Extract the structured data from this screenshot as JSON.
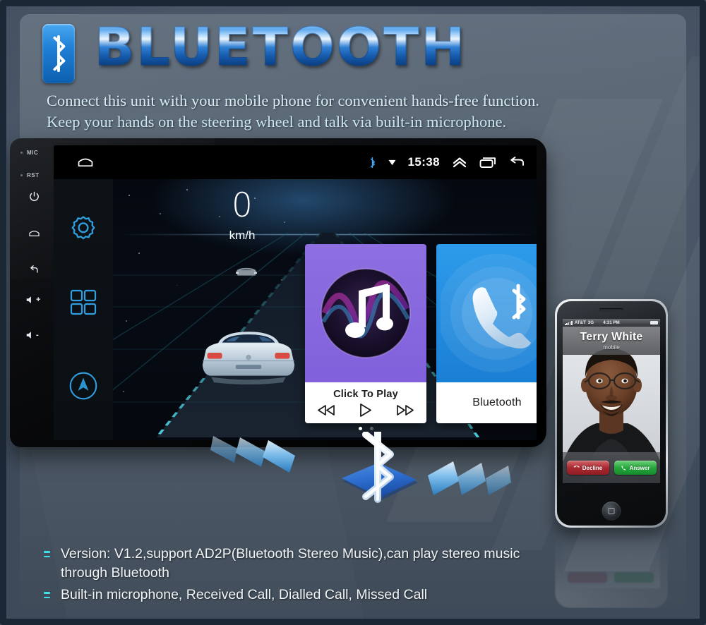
{
  "header": {
    "title": "BLUETOOTH",
    "badge_icon": "bluetooth-icon",
    "subtitle_line1": "Connect this unit with your mobile phone for convenient hands-free function.",
    "subtitle_line2": "Keep your hands on the steering wheel and talk via built-in microphone."
  },
  "head_unit": {
    "bezel": {
      "mic_label": "MIC",
      "rst_label": "RST",
      "keys": [
        "power-icon",
        "home-icon",
        "back-icon",
        "volume-up-icon",
        "volume-down-icon"
      ],
      "volume_up_label": "+",
      "volume_down_label": "-"
    },
    "status_bar": {
      "home_icon": "home-icon",
      "bluetooth_icon": "bluetooth-icon",
      "signal_icon": "signal-icon",
      "time": "15:38",
      "expand_icon": "chevron-up-icon",
      "recents_icon": "recents-icon",
      "back_icon": "back-icon"
    },
    "inner_sidebar": {
      "settings_icon": "gear-icon",
      "apps_icon": "apps-grid-icon",
      "navigation_icon": "navigation-compass-icon"
    },
    "speedometer": {
      "value": "0",
      "unit": "km/h"
    },
    "cards": [
      {
        "name": "music",
        "icon": "music-note-icon",
        "label": "Click To Play",
        "controls": [
          "previous-icon",
          "play-icon",
          "next-icon"
        ],
        "color": "#7d5ddb"
      },
      {
        "name": "bluetooth",
        "icon": "bluetooth-phone-icon",
        "label": "Bluetooth",
        "color": "#1477cf"
      }
    ],
    "page_dots": {
      "count": 2,
      "active": 0
    }
  },
  "beam": {
    "icon": "bluetooth-icon",
    "left_chevrons": 3,
    "right_chevrons": 3
  },
  "phone": {
    "carrier": "AT&T",
    "network": "3G",
    "time": "4:31 PM",
    "caller_name": "Terry White",
    "caller_type": "mobile",
    "decline_label": "Decline",
    "answer_label": "Answer",
    "decline_icon": "decline-call-icon",
    "answer_icon": "answer-call-icon",
    "home_button_icon": "home-square-icon"
  },
  "features": [
    "Version: V1.2,support AD2P(Bluetooth Stereo Music),can play stereo music through Bluetooth",
    "Built-in microphone, Received Call, Dialled Call, Missed Call"
  ],
  "colors": {
    "accent_blue": "#1f7fd6",
    "title_blue": "#2f7fd4",
    "bullet_cyan": "#3fe0e8",
    "panel_bg": "#56636f",
    "frame": "#1c2736"
  }
}
